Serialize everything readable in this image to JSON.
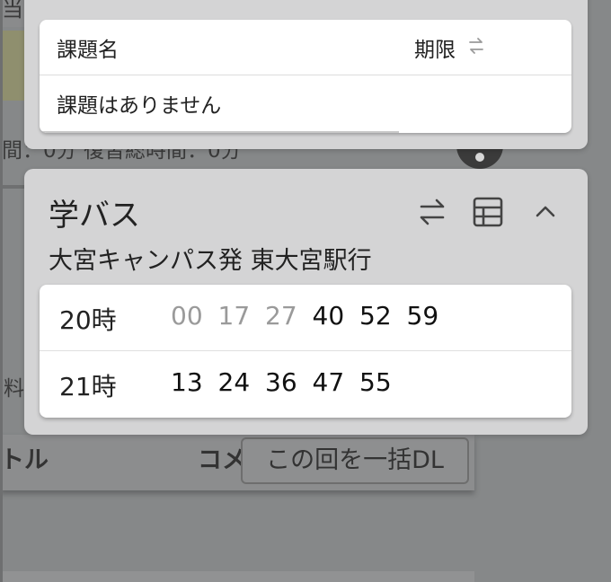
{
  "background": {
    "top_fragment": "当",
    "middle_fragment": "間：0分 復習総時間：0分",
    "left_fragment": "料",
    "column_title": "トル",
    "column_comment": "コメ",
    "download_button": "この回を一括DL"
  },
  "task_card": {
    "col_name": "課題名",
    "col_deadline": "期限",
    "sort_icon": "swap-vertical-icon",
    "empty_message": "課題はありません"
  },
  "bus_card": {
    "title": "学バス",
    "route": "大宮キャンパス発 東大宮駅行",
    "icons": {
      "swap": "swap-horizontal-icon",
      "table": "grid-table-icon",
      "collapse": "chevron-up-icon"
    },
    "rows": [
      {
        "hour": "20時",
        "minutes": [
          {
            "m": "00",
            "past": true
          },
          {
            "m": "17",
            "past": true
          },
          {
            "m": "27",
            "past": true
          },
          {
            "m": "40",
            "past": false
          },
          {
            "m": "52",
            "past": false
          },
          {
            "m": "59",
            "past": false
          }
        ]
      },
      {
        "hour": "21時",
        "minutes": [
          {
            "m": "13",
            "past": false
          },
          {
            "m": "24",
            "past": false
          },
          {
            "m": "36",
            "past": false
          },
          {
            "m": "47",
            "past": false
          },
          {
            "m": "55",
            "past": false
          }
        ]
      }
    ]
  },
  "colors": {
    "past_minute": "#9a9a9a",
    "active_minute": "#111111",
    "overlay": "#868889"
  }
}
